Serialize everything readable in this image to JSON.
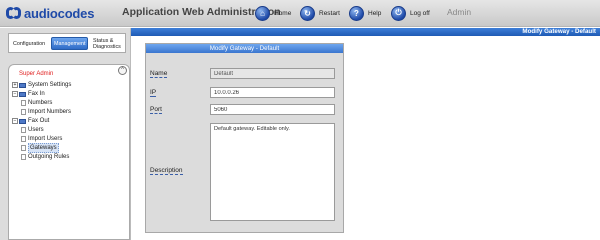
{
  "header": {
    "logo_text": "audiocodes",
    "app_title": "Application Web Administration",
    "buttons": [
      {
        "label": "Home",
        "icon": "home-icon"
      },
      {
        "label": "Restart",
        "icon": "restart-icon"
      },
      {
        "label": "Help",
        "icon": "help-icon"
      },
      {
        "label": "Log off",
        "icon": "logoff-icon"
      }
    ],
    "user": "Admin"
  },
  "page_title": "Modify Gateway - Default",
  "nav": {
    "tabs": [
      "Configuration",
      "Management",
      "Status & Diagnostics"
    ],
    "active_tab": "Management",
    "role": "Super Admin",
    "tree": {
      "system_settings": "System Settings",
      "fax_in": "Fax In",
      "numbers": "Numbers",
      "import_numbers": "Import Numbers",
      "fax_out": "Fax Out",
      "users": "Users",
      "import_users": "Import Users",
      "gateways": "Gateways",
      "outgoing_rules": "Outgoing Rules"
    }
  },
  "form": {
    "title": "Modify Gateway - Default",
    "fields": {
      "name": {
        "label": "Name",
        "value": "Default"
      },
      "ip": {
        "label": "IP",
        "value": "10.0.0.26"
      },
      "port": {
        "label": "Port",
        "value": "5060"
      },
      "description": {
        "label": "Description",
        "value": "Default gateway. Editable only."
      }
    }
  },
  "colors": {
    "brand_blue": "#1f4aa8",
    "strip_blue": "#2f6cc7",
    "super_admin_red": "#e02020"
  }
}
